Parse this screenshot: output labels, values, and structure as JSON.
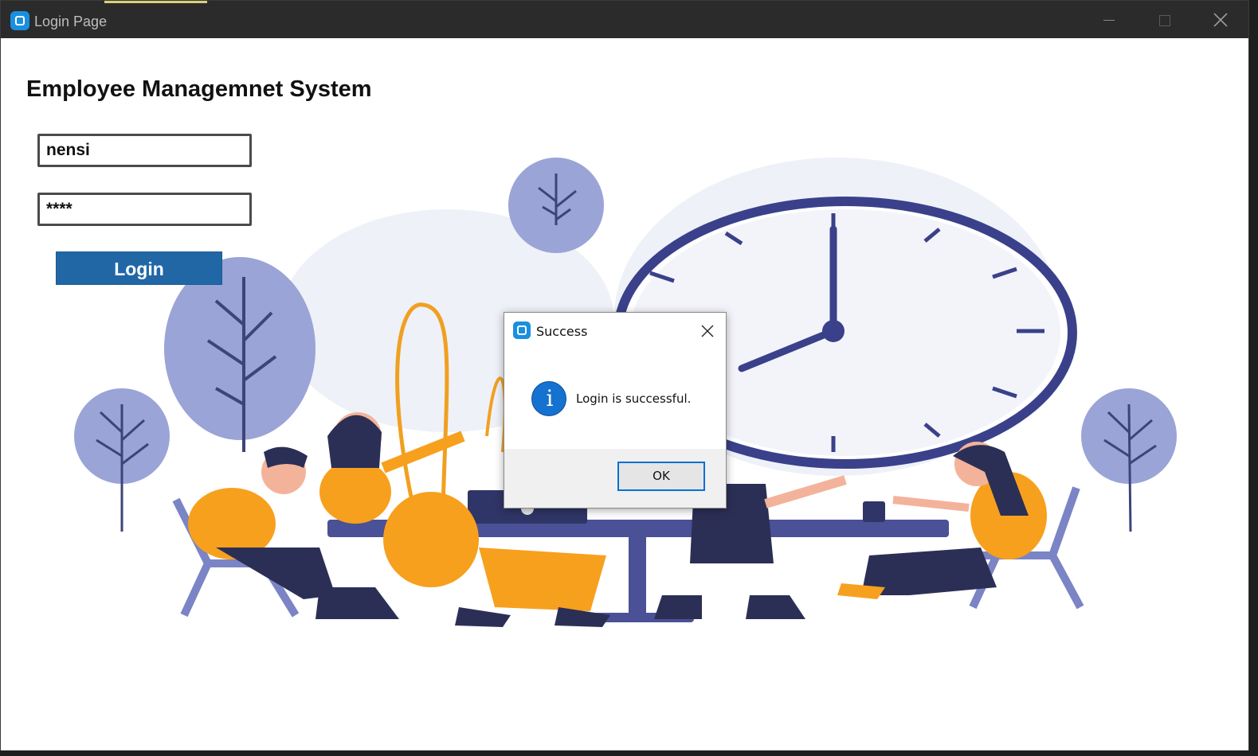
{
  "window": {
    "title": "Login Page",
    "accent_color": "#1a8fe0"
  },
  "form": {
    "heading": "Employee Managemnet System",
    "username_value": "nensi",
    "password_value": "****",
    "login_label": "Login",
    "login_color": "#2167a6"
  },
  "dialog": {
    "title": "Success",
    "message": "Login is successful.",
    "ok_label": "OK",
    "info_icon": "info-icon"
  }
}
